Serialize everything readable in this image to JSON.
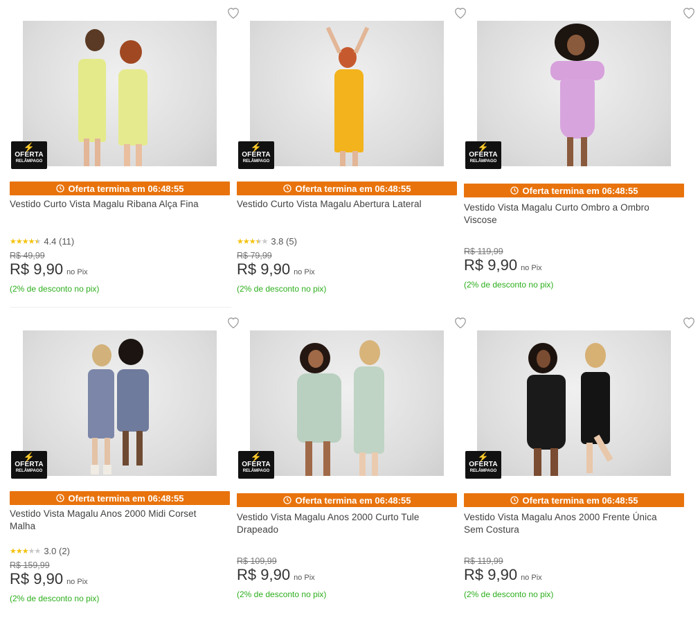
{
  "colors": {
    "timer_bg": "#e8730d",
    "discount_text": "#2dae1d",
    "star": "#f4c20d",
    "badge_bg": "#111111"
  },
  "badge": {
    "line1": "OFERTA",
    "line2": "RELÂMPAGO",
    "icon": "lightning-icon"
  },
  "products": [
    {
      "timer": "Oferta termina em 06:48:55",
      "title": "Vestido Curto Vista Magalu Ribana Alça Fina",
      "stars": 4.5,
      "rating": "4.4 (11)",
      "old_price": "R$ 49,99",
      "price": "R$ 9,90",
      "price_suffix": "no Pix",
      "discount": "(2% de desconto no pix)"
    },
    {
      "timer": "Oferta termina em 06:48:55",
      "title": "Vestido Curto Vista Magalu Abertura Lateral",
      "stars": 3.5,
      "rating": "3.8 (5)",
      "old_price": "R$ 79,99",
      "price": "R$ 9,90",
      "price_suffix": "no Pix",
      "discount": "(2% de desconto no pix)"
    },
    {
      "timer": "Oferta termina em 06:48:55",
      "title": "Vestido Vista Magalu Curto Ombro a Ombro Viscose",
      "old_price": "R$ 119,99",
      "price": "R$ 9,90",
      "price_suffix": "no Pix",
      "discount": "(2% de desconto no pix)"
    },
    {
      "timer": "Oferta termina em 06:48:55",
      "title": "Vestido Vista Magalu Anos 2000 Midi Corset Malha",
      "stars": 3,
      "rating": "3.0 (2)",
      "old_price": "R$ 159,99",
      "price": "R$ 9,90",
      "price_suffix": "no Pix",
      "discount": "(2% de desconto no pix)"
    },
    {
      "timer": "Oferta termina em 06:48:55",
      "title": "Vestido Vista Magalu Anos 2000 Curto Tule Drapeado",
      "old_price": "R$ 109,99",
      "price": "R$ 9,90",
      "price_suffix": "no Pix",
      "discount": "(2% de desconto no pix)"
    },
    {
      "timer": "Oferta termina em 06:48:55",
      "title": "Vestido Vista Magalu Anos 2000 Frente Única Sem Costura",
      "old_price": "R$ 119,99",
      "price": "R$ 9,90",
      "price_suffix": "no Pix",
      "discount": "(2% de desconto no pix)"
    }
  ]
}
